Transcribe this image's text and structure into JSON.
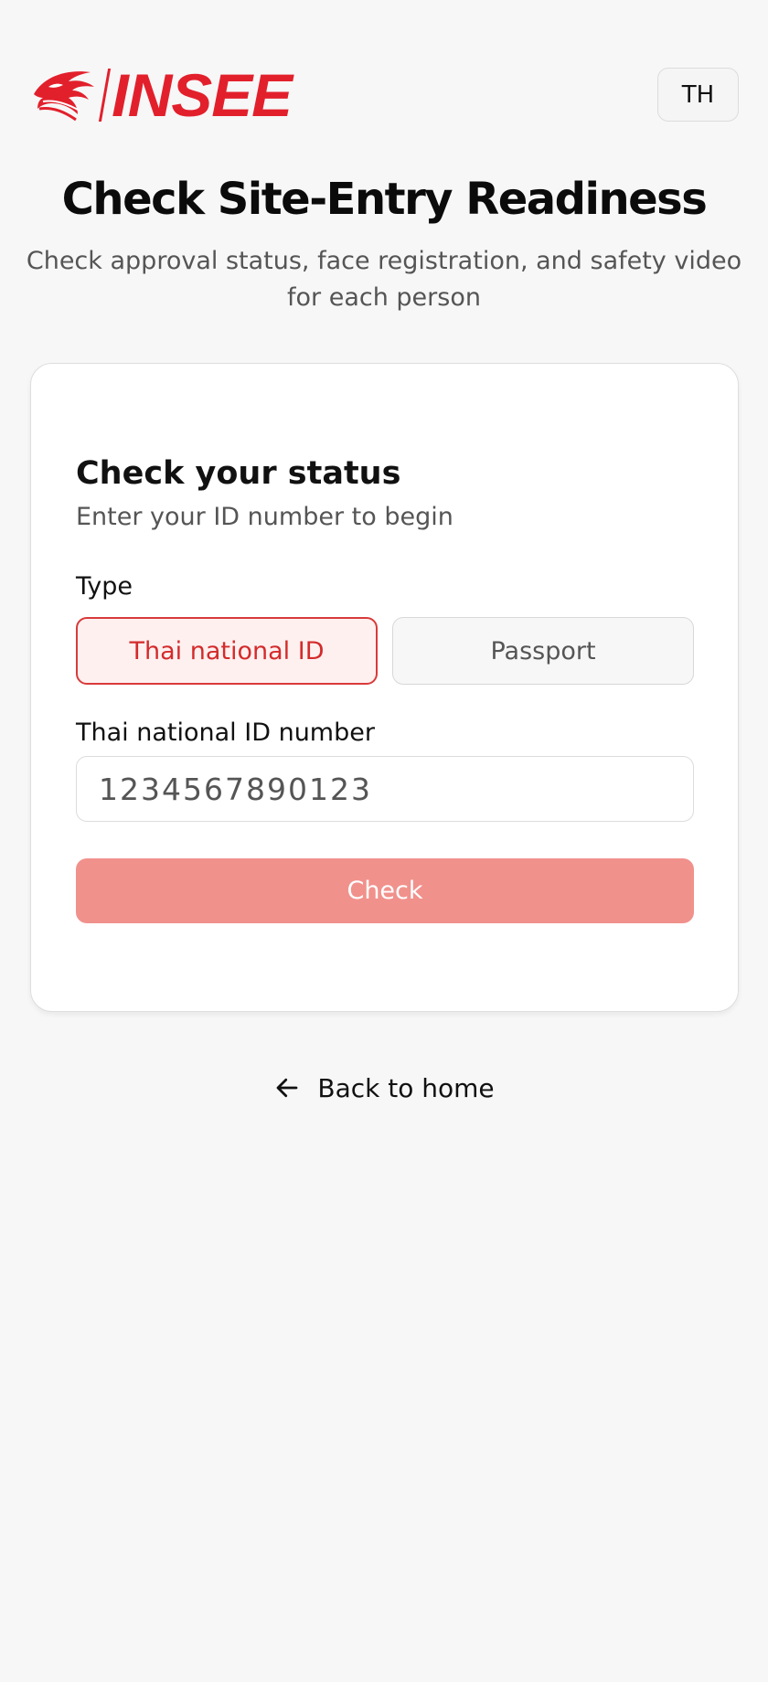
{
  "header": {
    "logo_text": "INSEE",
    "language_button": "TH"
  },
  "hero": {
    "title": "Check Site-Entry Readiness",
    "subtitle": "Check approval status, face registration, and safety video for each person"
  },
  "card": {
    "title": "Check your status",
    "subtitle": "Enter your ID number to begin",
    "type_label": "Type",
    "type_options": [
      {
        "label": "Thai national ID",
        "selected": true
      },
      {
        "label": "Passport",
        "selected": false
      }
    ],
    "id_label": "Thai national ID number",
    "id_placeholder": "1234567890123",
    "submit_label": "Check"
  },
  "footer": {
    "back_label": "Back to home"
  },
  "colors": {
    "brand_red": "#e2202c",
    "active_border": "#d93a3a",
    "active_bg": "#fff0f0",
    "button_disabled": "#f1918c",
    "page_bg": "#f7f7f7"
  },
  "icons": {
    "logo": "eagle-head-icon",
    "back": "arrow-left-icon"
  }
}
